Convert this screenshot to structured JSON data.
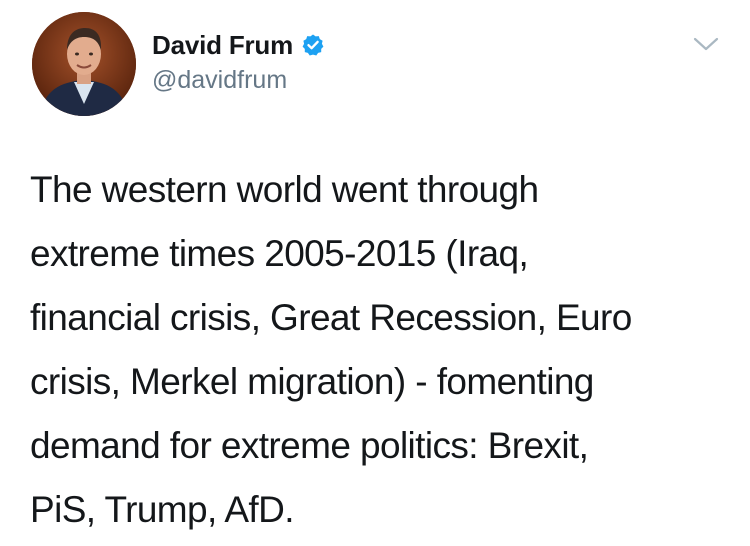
{
  "author": {
    "display_name": "David Frum",
    "handle": "@davidfrum",
    "verified": true
  },
  "icons": {
    "verified": "verified-badge-icon",
    "more": "chevron-down-icon"
  },
  "colors": {
    "verified_blue": "#1da1f2",
    "handle_gray": "#657786",
    "text": "#14171a"
  },
  "tweet": {
    "lines": [
      "The western world went through",
      "extreme times 2005-2015 (Iraq,",
      "financial crisis, Great Recession, Euro",
      "crisis, Merkel migration) - fomenting",
      "demand for extreme politics: Brexit,",
      "PiS, Trump, AfD."
    ]
  }
}
